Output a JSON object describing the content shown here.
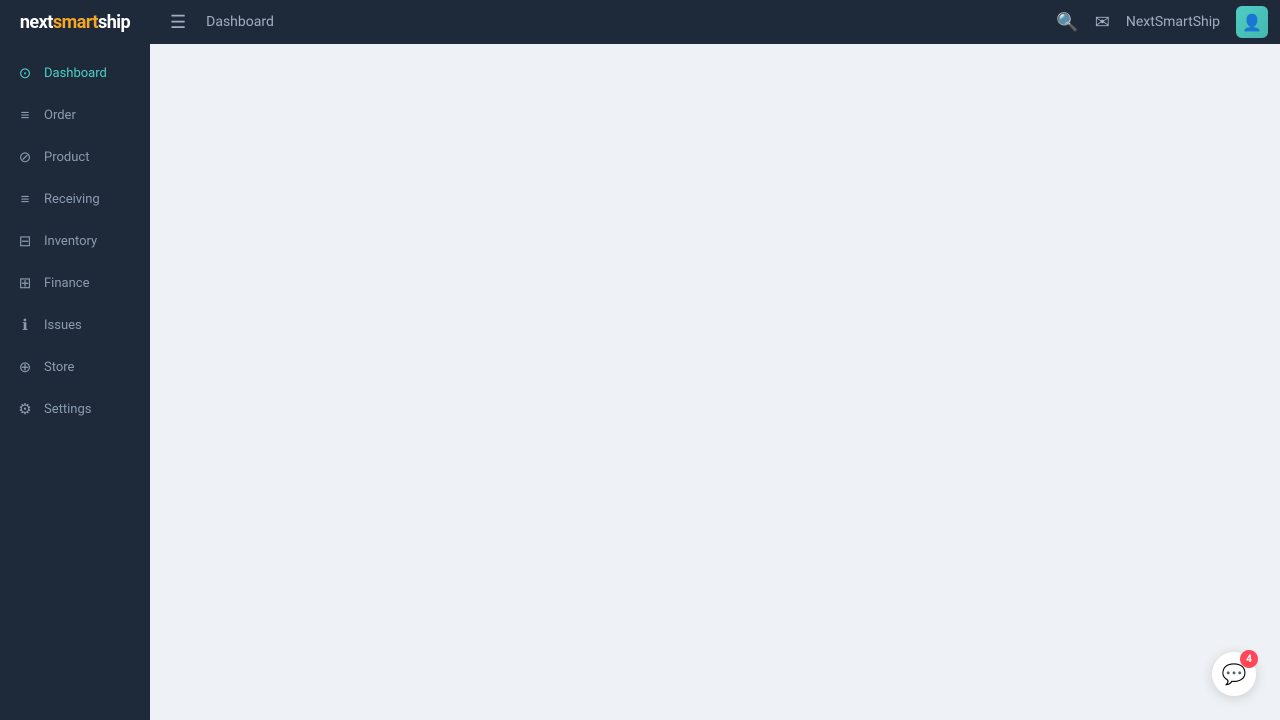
{
  "app": {
    "logo_prefix": "next",
    "logo_brand": "smart",
    "logo_suffix": "ship"
  },
  "header": {
    "breadcrumb": "Dashboard",
    "username": "NextSmartShip",
    "hamburger_symbol": "☰",
    "search_symbol": "🔍",
    "mail_symbol": "✉",
    "avatar_symbol": "👤"
  },
  "sidebar": {
    "items": [
      {
        "id": "dashboard",
        "label": "Dashboard",
        "icon": "⊙",
        "active": true
      },
      {
        "id": "order",
        "label": "Order",
        "icon": "≡",
        "active": false
      },
      {
        "id": "product",
        "label": "Product",
        "icon": "⊘",
        "active": false
      },
      {
        "id": "receiving",
        "label": "Receiving",
        "icon": "≡",
        "active": false
      },
      {
        "id": "inventory",
        "label": "Inventory",
        "icon": "⊟",
        "active": false
      },
      {
        "id": "finance",
        "label": "Finance",
        "icon": "⊞",
        "active": false
      },
      {
        "id": "issues",
        "label": "Issues",
        "icon": "ℹ",
        "active": false
      },
      {
        "id": "store",
        "label": "Store",
        "icon": "⊕",
        "active": false
      },
      {
        "id": "settings",
        "label": "Settings",
        "icon": "⚙",
        "active": false
      }
    ]
  },
  "chat": {
    "badge_count": "4",
    "icon_symbol": "💬"
  }
}
